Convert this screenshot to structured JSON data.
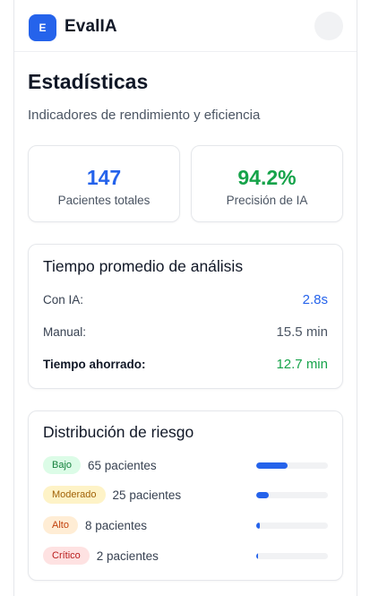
{
  "header": {
    "logo_letter": "E",
    "app_name": "EvalIA"
  },
  "page": {
    "title": "Estadísticas",
    "subtitle": "Indicadores de rendimiento y eficiencia"
  },
  "stats": [
    {
      "value": "147",
      "label": "Pacientes totales",
      "color": "#2563eb"
    },
    {
      "value": "94.2%",
      "label": "Precisión de IA",
      "color": "#16a34a"
    }
  ],
  "analysis_time": {
    "title": "Tiempo promedio de análisis",
    "rows": [
      {
        "label": "Con IA:",
        "value": "2.8s",
        "color": "#2563eb"
      },
      {
        "label": "Manual:",
        "value": "15.5 min",
        "color": "#4b5563"
      },
      {
        "label": "Tiempo ahorrado:",
        "value": "12.7 min",
        "color": "#16a34a"
      }
    ]
  },
  "risk_distribution": {
    "title": "Distribución de riesgo",
    "bar_color": "#2563eb",
    "items": [
      {
        "level": "Bajo",
        "count_text": "65 pacientes",
        "fraction": 0.442,
        "badge_bg": "#dcfce7",
        "badge_fg": "#15803d"
      },
      {
        "level": "Moderado",
        "count_text": "25 pacientes",
        "fraction": 0.17,
        "badge_bg": "#fef3c7",
        "badge_fg": "#a16207"
      },
      {
        "level": "Alto",
        "count_text": "8 pacientes",
        "fraction": 0.054,
        "badge_bg": "#ffedd5",
        "badge_fg": "#c2410c"
      },
      {
        "level": "Crítico",
        "count_text": "2 pacientes",
        "fraction": 0.014,
        "badge_bg": "#fee2e2",
        "badge_fg": "#b91c1c"
      }
    ]
  }
}
